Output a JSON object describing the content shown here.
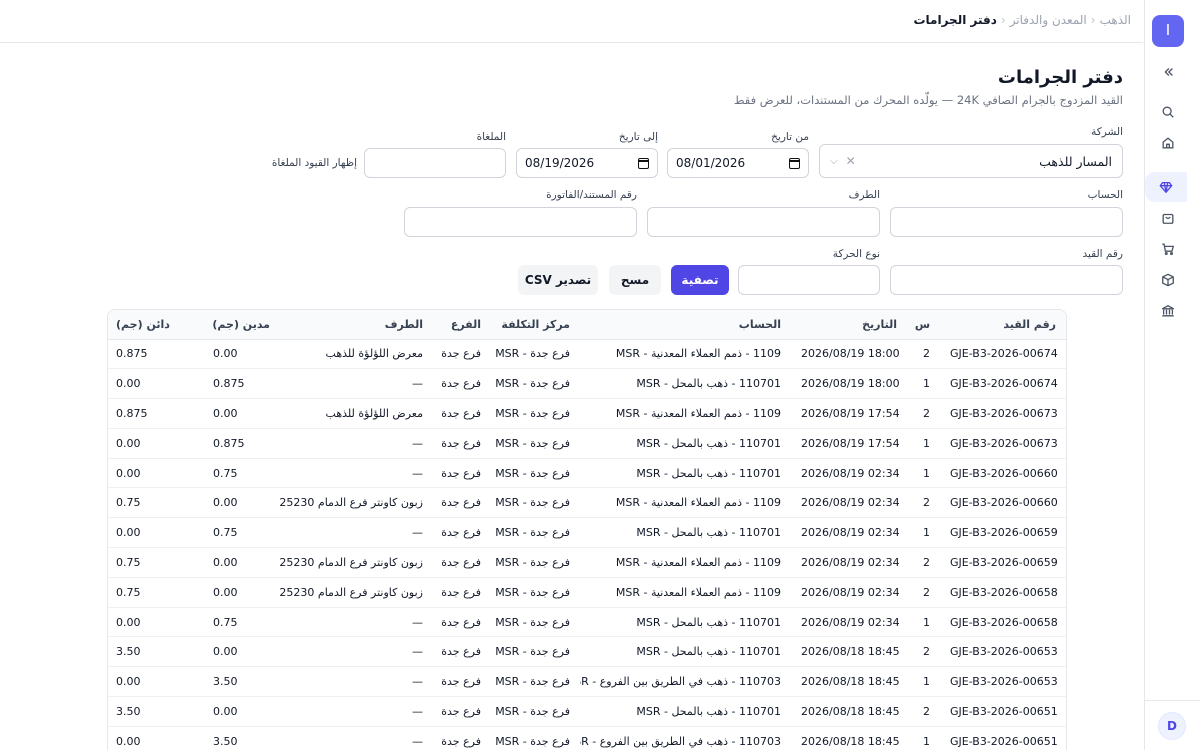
{
  "app": {
    "logo_letter": "I",
    "user_initial": "D"
  },
  "breadcrumb": {
    "root": "الذهب",
    "section": "المعدن والدفاتر",
    "current": "دفتر الجرامات",
    "separator": "‹"
  },
  "page": {
    "title": "دفتر الجرامات",
    "subtitle": "القيد المزدوج بالجرام الصافي 24K — يولّده المحرك من المستندات، للعرض فقط"
  },
  "filters": {
    "company_label": "الشركة",
    "company_value": "المسار للذهب",
    "from_date_label": "من تاريخ",
    "from_date_value": "08/01/2026",
    "to_date_label": "إلى تاريخ",
    "to_date_value": "08/19/2026",
    "voided_label": "الملغاة",
    "voided_value": "",
    "show_voided_label": "إظهار القيود الملغاة",
    "account_label": "الحساب",
    "account_value": "",
    "party_label": "الطرف",
    "party_value": "",
    "document_label": "رقم المستند/الفاتورة",
    "document_value": "",
    "entry_no_label": "رقم القيد",
    "entry_no_value": "",
    "movement_type_label": "نوع الحركة",
    "movement_type_value": ""
  },
  "actions": {
    "filter": "تصفية",
    "clear": "مسح",
    "export": "تصدير CSV"
  },
  "table": {
    "columns": [
      "رقم القيد",
      "س",
      "التاريخ",
      "الحساب",
      "مركز التكلفة",
      "الفرع",
      "الطرف",
      "مدين (جم)",
      "دائن (جم)"
    ],
    "rows": [
      [
        "GJE-B3-2026-00674",
        "2",
        "2026/08/19 18:00",
        "1109 - ذمم العملاء المعدنية - MSR",
        "فرع جدة - MSR",
        "فرع جدة",
        "معرض اللؤلؤة للذهب",
        "0.00",
        "0.875"
      ],
      [
        "GJE-B3-2026-00674",
        "1",
        "2026/08/19 18:00",
        "110701 - ذهب بالمحل - MSR",
        "فرع جدة - MSR",
        "فرع جدة",
        "—",
        "0.875",
        "0.00"
      ],
      [
        "GJE-B3-2026-00673",
        "2",
        "2026/08/19 17:54",
        "1109 - ذمم العملاء المعدنية - MSR",
        "فرع جدة - MSR",
        "فرع جدة",
        "معرض اللؤلؤة للذهب",
        "0.00",
        "0.875"
      ],
      [
        "GJE-B3-2026-00673",
        "1",
        "2026/08/19 17:54",
        "110701 - ذهب بالمحل - MSR",
        "فرع جدة - MSR",
        "فرع جدة",
        "—",
        "0.875",
        "0.00"
      ],
      [
        "GJE-B3-2026-00660",
        "1",
        "2026/08/19 02:34",
        "110701 - ذهب بالمحل - MSR",
        "فرع جدة - MSR",
        "فرع جدة",
        "—",
        "0.75",
        "0.00"
      ],
      [
        "GJE-B3-2026-00660",
        "2",
        "2026/08/19 02:34",
        "1109 - ذمم العملاء المعدنية - MSR",
        "فرع جدة - MSR",
        "فرع جدة",
        "زبون كاونتر فرع الدمام 425230",
        "0.00",
        "0.75"
      ],
      [
        "GJE-B3-2026-00659",
        "1",
        "2026/08/19 02:34",
        "110701 - ذهب بالمحل - MSR",
        "فرع جدة - MSR",
        "فرع جدة",
        "—",
        "0.75",
        "0.00"
      ],
      [
        "GJE-B3-2026-00659",
        "2",
        "2026/08/19 02:34",
        "1109 - ذمم العملاء المعدنية - MSR",
        "فرع جدة - MSR",
        "فرع جدة",
        "زبون كاونتر فرع الدمام 425230",
        "0.00",
        "0.75"
      ],
      [
        "GJE-B3-2026-00658",
        "2",
        "2026/08/19 02:34",
        "1109 - ذمم العملاء المعدنية - MSR",
        "فرع جدة - MSR",
        "فرع جدة",
        "زبون كاونتر فرع الدمام 425230",
        "0.00",
        "0.75"
      ],
      [
        "GJE-B3-2026-00658",
        "1",
        "2026/08/19 02:34",
        "110701 - ذهب بالمحل - MSR",
        "فرع جدة - MSR",
        "فرع جدة",
        "—",
        "0.75",
        "0.00"
      ],
      [
        "GJE-B3-2026-00653",
        "2",
        "2026/08/18 18:45",
        "110701 - ذهب بالمحل - MSR",
        "فرع جدة - MSR",
        "فرع جدة",
        "—",
        "0.00",
        "3.50"
      ],
      [
        "GJE-B3-2026-00653",
        "1",
        "2026/08/18 18:45",
        "110703 - ذهب في الطريق بين الفروع - MSR",
        "فرع جدة - MSR",
        "فرع جدة",
        "—",
        "3.50",
        "0.00"
      ],
      [
        "GJE-B3-2026-00651",
        "2",
        "2026/08/18 18:45",
        "110701 - ذهب بالمحل - MSR",
        "فرع جدة - MSR",
        "فرع جدة",
        "—",
        "0.00",
        "3.50"
      ],
      [
        "GJE-B3-2026-00651",
        "1",
        "2026/08/18 18:45",
        "110703 - ذهب في الطريق بين الفروع - MSR",
        "فرع جدة - MSR",
        "فرع جدة",
        "—",
        "3.50",
        "0.00"
      ]
    ]
  },
  "sidebar": {
    "icons": [
      "expand-icon",
      "search-icon",
      "home-icon",
      "gem-icon",
      "bag-icon",
      "cart-icon",
      "box-icon",
      "bank-icon"
    ],
    "accent": "#4f46e5"
  }
}
